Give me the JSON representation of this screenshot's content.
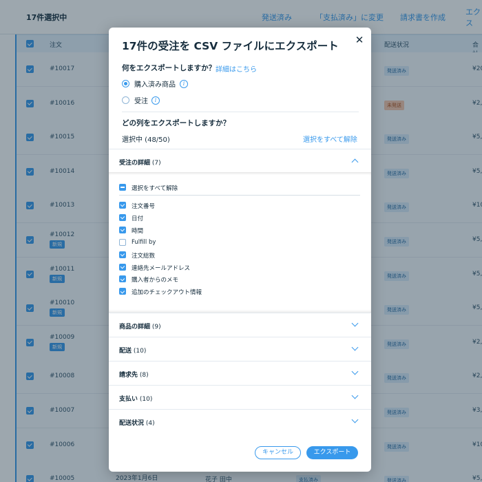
{
  "background": {
    "selected_count": "17件選択中",
    "actions": [
      "発送済み",
      "「支払済み」に変更",
      "請求書を作成",
      "エクス"
    ],
    "columns": [
      "注文",
      "配送状況",
      "合計"
    ],
    "rows": [
      {
        "order": "#10017",
        "new": "",
        "status": "発送済み",
        "status_type": "shipped",
        "amount": "¥20"
      },
      {
        "order": "#10016",
        "new": "",
        "status": "未発送",
        "status_type": "unshipped",
        "amount": "¥2,"
      },
      {
        "order": "#10015",
        "new": "",
        "status": "発送済み",
        "status_type": "shipped",
        "amount": "¥5,"
      },
      {
        "order": "#10014",
        "new": "",
        "status": "発送済み",
        "status_type": "shipped",
        "amount": "¥5,"
      },
      {
        "order": "#10013",
        "new": "",
        "status": "発送済み",
        "status_type": "shipped",
        "amount": "¥10"
      },
      {
        "order": "#10012",
        "new": "新規",
        "status": "発送済み",
        "status_type": "shipped",
        "amount": "¥5,"
      },
      {
        "order": "#10011",
        "new": "新規",
        "status": "発送済み",
        "status_type": "shipped",
        "amount": "¥5,"
      },
      {
        "order": "#10010",
        "new": "新規",
        "status": "発送済み",
        "status_type": "shipped",
        "amount": "¥5,"
      },
      {
        "order": "#10009",
        "new": "新規",
        "status": "発送済み",
        "status_type": "shipped",
        "amount": "¥2,"
      },
      {
        "order": "#10008",
        "new": "",
        "status": "発送済み",
        "status_type": "shipped",
        "amount": "¥2,"
      },
      {
        "order": "#10007",
        "new": "",
        "status": "発送済み",
        "status_type": "shipped",
        "amount": "¥3,"
      },
      {
        "order": "#10006",
        "new": "",
        "status": "発送済み",
        "status_type": "shipped",
        "amount": "¥10"
      },
      {
        "order": "#10005",
        "new": "",
        "status": "発送済み",
        "status_type": "shipped",
        "amount": "¥5,"
      }
    ],
    "last_row_date": "2023年1月6日",
    "last_row_customer": "花子 田中",
    "last_row_payment": "支払済み"
  },
  "modal": {
    "title": "17件の受注を CSV ファイルにエクスポート",
    "close_icon": "close-icon",
    "question_what": "何をエクスポートしますか？",
    "learn_more": "詳細はこちら",
    "options": [
      {
        "label": "購入済み商品",
        "selected": true
      },
      {
        "label": "受注",
        "selected": false
      }
    ],
    "question_columns": "どの列をエクスポートしますか？",
    "selected_count": "選択中 (48/50)",
    "deselect_all": "選択をすべて解除",
    "order_details": {
      "title": "受注の詳細",
      "count": "(7)",
      "deselect_all": "選択をすべて解除",
      "fields": [
        {
          "label": "注文番号",
          "checked": true
        },
        {
          "label": "日付",
          "checked": true
        },
        {
          "label": "時間",
          "checked": true
        },
        {
          "label": "Fulfill by",
          "checked": false
        },
        {
          "label": "注文総数",
          "checked": true
        },
        {
          "label": "連絡先メールアドレス",
          "checked": true
        },
        {
          "label": "購入者からのメモ",
          "checked": true
        },
        {
          "label": "追加のチェックアウト情報",
          "checked": true
        }
      ]
    },
    "sections": [
      {
        "title": "商品の詳細",
        "count": "(9)"
      },
      {
        "title": "配送",
        "count": "(10)"
      },
      {
        "title": "請求先",
        "count": "(8)"
      },
      {
        "title": "支払い",
        "count": "(10)"
      },
      {
        "title": "配送状況",
        "count": "(4)"
      }
    ],
    "cancel": "キャンセル",
    "export": "エクスポート"
  },
  "colors": {
    "accent": "#3899ec",
    "unshipped": "#f6c7ad"
  }
}
